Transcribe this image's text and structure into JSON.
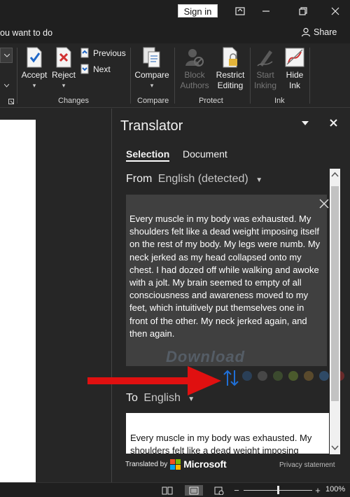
{
  "titlebar": {
    "signin_label": "Sign in"
  },
  "tellme": {
    "text": "ou want to do"
  },
  "share": {
    "label": "Share"
  },
  "ribbon": {
    "accept_label": "Accept",
    "reject_label": "Reject",
    "previous_label": "Previous",
    "next_label": "Next",
    "changes_group": "Changes",
    "compare_label": "Compare",
    "compare_group": "Compare",
    "block_authors_line1": "Block",
    "block_authors_line2": "Authors",
    "restrict_editing_line1": "Restrict",
    "restrict_editing_line2": "Editing",
    "protect_group": "Protect",
    "start_inking_line1": "Start",
    "start_inking_line2": "Inking",
    "hide_ink_line1": "Hide",
    "hide_ink_line2": "Ink",
    "ink_group": "Ink"
  },
  "translator": {
    "title": "Translator",
    "tabs": [
      "Selection",
      "Document"
    ],
    "from_label": "From",
    "from_lang": "English (detected)",
    "source_text": "Every muscle in my body was exhausted. My shoulders felt like a dead weight imposing itself on the rest of my body. My legs were numb. My neck jerked as my head collapsed onto my chest. I had dozed off while walking and awoke with a jolt. My brain seemed to empty of all consciousness and awareness moved to my feet, which intuitively put themselves one in front of the other. My neck jerked again, and then again.",
    "watermark": "Download",
    "to_label": "To",
    "to_lang": "English",
    "target_text": "Every muscle in my body was exhausted. My shoulders felt like a dead weight imposing",
    "translated_by": "Translated by",
    "brand": "Microsoft",
    "privacy": "Privacy statement"
  },
  "colors": {
    "dots": [
      "#2a3f57",
      "#474747",
      "#3b4a2e",
      "#4a5a2c",
      "#5a4a2c",
      "#2f4a66",
      "#6a2a2a"
    ],
    "arrow": "#e01010",
    "swap": "#1f6fd6"
  },
  "statusbar": {
    "zoom": "100%"
  }
}
